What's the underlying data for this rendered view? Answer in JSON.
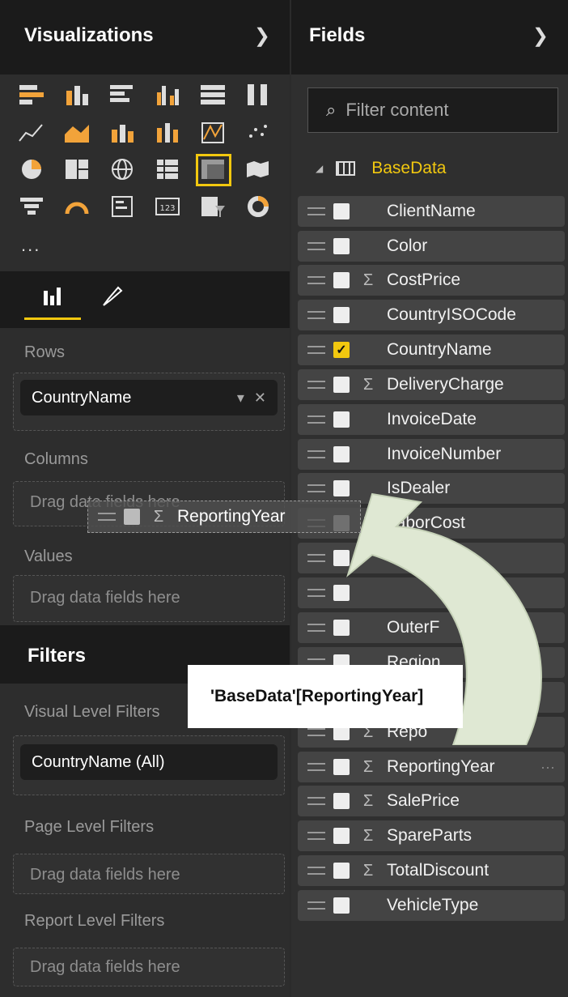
{
  "visualizations": {
    "title": "Visualizations",
    "more": "...",
    "tabs": [
      {
        "name": "fields-tab"
      },
      {
        "name": "format-tab"
      }
    ]
  },
  "wells": {
    "rows_label": "Rows",
    "rows_value": "CountryName",
    "columns_label": "Columns",
    "columns_placeholder": "Drag data fields here",
    "values_label": "Values",
    "values_placeholder": "Drag data fields here"
  },
  "filters": {
    "title": "Filters",
    "visual_label": "Visual Level Filters",
    "visual_value": "CountryName (All)",
    "page_label": "Page Level Filters",
    "page_placeholder": "Drag data fields here",
    "report_label": "Report Level Filters",
    "report_placeholder": "Drag data fields here"
  },
  "fields": {
    "title": "Fields",
    "search_placeholder": "Filter content",
    "table_name": "BaseData",
    "items": [
      {
        "name": "ClientName",
        "sigma": false,
        "checked": false
      },
      {
        "name": "Color",
        "sigma": false,
        "checked": false
      },
      {
        "name": "CostPrice",
        "sigma": true,
        "checked": false
      },
      {
        "name": "CountryISOCode",
        "sigma": false,
        "checked": false
      },
      {
        "name": "CountryName",
        "sigma": false,
        "checked": true
      },
      {
        "name": "DeliveryCharge",
        "sigma": true,
        "checked": false
      },
      {
        "name": "InvoiceDate",
        "sigma": false,
        "checked": false
      },
      {
        "name": "InvoiceNumber",
        "sigma": false,
        "checked": false
      },
      {
        "name": "IsDealer",
        "sigma": false,
        "checked": false
      },
      {
        "name": "LaborCost",
        "sigma": true,
        "checked": false
      },
      {
        "name": "",
        "sigma": false,
        "checked": false
      },
      {
        "name": "",
        "sigma": false,
        "checked": false
      },
      {
        "name": "OuterF",
        "sigma": false,
        "checked": false
      },
      {
        "name": "Region",
        "sigma": false,
        "checked": false
      },
      {
        "name": "",
        "sigma": false,
        "checked": false
      },
      {
        "name": "Repo",
        "sigma": true,
        "checked": false
      },
      {
        "name": "ReportingYear",
        "sigma": true,
        "checked": false
      },
      {
        "name": "SalePrice",
        "sigma": true,
        "checked": false
      },
      {
        "name": "SpareParts",
        "sigma": true,
        "checked": false
      },
      {
        "name": "TotalDiscount",
        "sigma": true,
        "checked": false
      },
      {
        "name": "VehicleType",
        "sigma": false,
        "checked": false
      }
    ]
  },
  "drag": {
    "field": "ReportingYear",
    "tooltip": "'BaseData'[ReportingYear]"
  },
  "colors": {
    "accent": "#f2c80f",
    "arrow_fill": "#dfe8d3"
  }
}
